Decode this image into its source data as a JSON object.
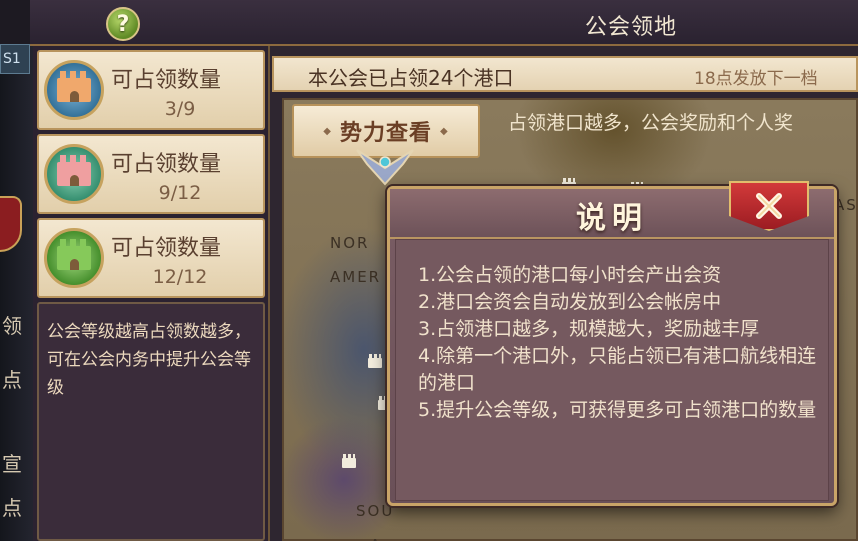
{
  "header": {
    "help_label": "?",
    "title": "公会领地"
  },
  "edge": {
    "tab_label": "S1",
    "chars": [
      "领",
      "点",
      "宣",
      "点"
    ]
  },
  "quotas": [
    {
      "label": "可占领数量",
      "value": "3/9",
      "emblem": "blue-castle-emblem"
    },
    {
      "label": "可占领数量",
      "value": "9/12",
      "emblem": "teal-castle-emblem"
    },
    {
      "label": "可占领数量",
      "value": "12/12",
      "emblem": "green-castle-emblem"
    }
  ],
  "sidebar_desc": "公会等级越高占领数越多，可在公会内务中提升公会等级",
  "main": {
    "occupied_text": "本公会已占领24个港口",
    "timer_text": "18点发放下一档",
    "power_button": "势力查看",
    "hint_text": "占领港口越多，公会奖励和个人奖",
    "map_labels": [
      "NOR",
      "AMER",
      "SOU",
      "A",
      "ASI"
    ]
  },
  "modal": {
    "title": "说明",
    "close_icon": "close-icon",
    "lines": [
      "1.公会占领的港口每小时会产出会资",
      "2.港口会资会自动发放到公会帐房中",
      "3.占领港口越多，规模越大，奖励越丰厚",
      "4.除第一个港口外，只能占领已有港口航线相连的港口",
      "5.提升公会等级，可获得更多可占领港口的数量"
    ]
  },
  "colors": {
    "accent_gold": "#c9a468",
    "close_red": "#c22f33",
    "help_green": "#7fae3a"
  }
}
